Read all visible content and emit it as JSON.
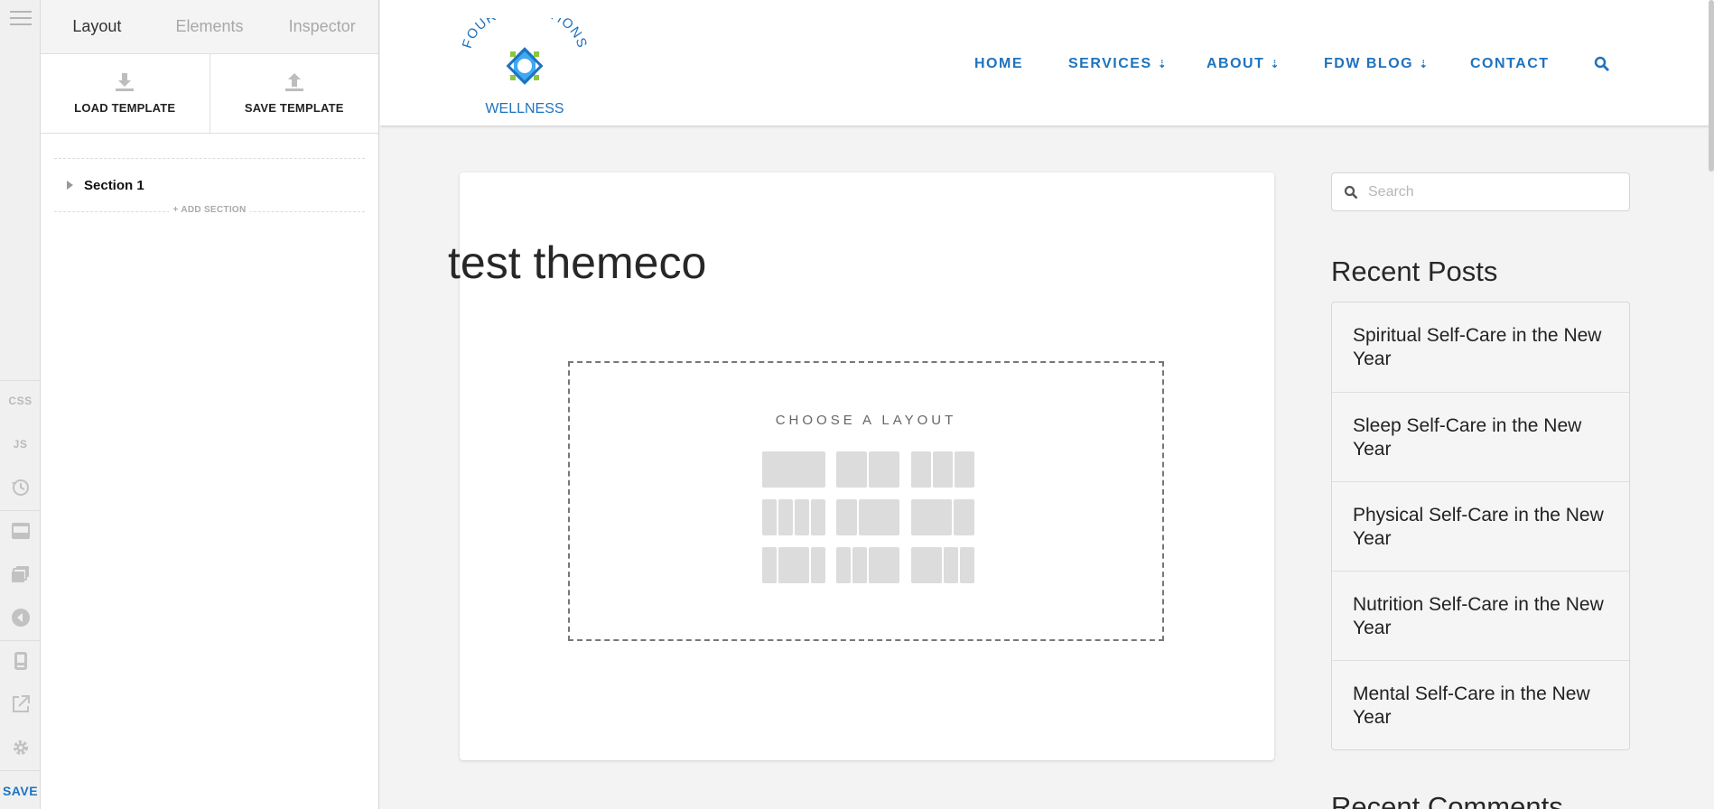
{
  "sidebar_rail": {
    "css_label": "CSS",
    "js_label": "JS",
    "save_label": "SAVE"
  },
  "builder": {
    "tabs": [
      "Layout",
      "Elements",
      "Inspector"
    ],
    "active_tab": "Layout",
    "load_template_label": "LOAD TEMPLATE",
    "save_template_label": "SAVE TEMPLATE",
    "sections": [
      "Section 1"
    ],
    "add_section_label": "+ ADD SECTION"
  },
  "site": {
    "logo": {
      "top_text": "FOUR DIRECTIONS",
      "bottom_text": "WELLNESS",
      "colors": {
        "blue": "#1e73be",
        "green": "#8dc63f",
        "light_blue": "#3fa9f5"
      }
    },
    "nav": [
      {
        "label": "HOME",
        "dropdown": false
      },
      {
        "label": "SERVICES",
        "dropdown": true
      },
      {
        "label": "ABOUT",
        "dropdown": true
      },
      {
        "label": "FDW BLOG",
        "dropdown": true
      },
      {
        "label": "CONTACT",
        "dropdown": false
      }
    ],
    "accent_color": "#1e73be",
    "post_title": "test themeco",
    "choose_layout_label": "CHOOSE A LAYOUT",
    "search_placeholder": "Search",
    "recent_posts_title": "Recent Posts",
    "recent_posts": [
      "Spiritual Self-Care in the New Year",
      "Sleep Self-Care in the New Year",
      "Physical Self-Care in the New Year",
      "Nutrition Self-Care in the New Year",
      "Mental Self-Care in the New Year"
    ],
    "recent_comments_title": "Recent Comments"
  }
}
